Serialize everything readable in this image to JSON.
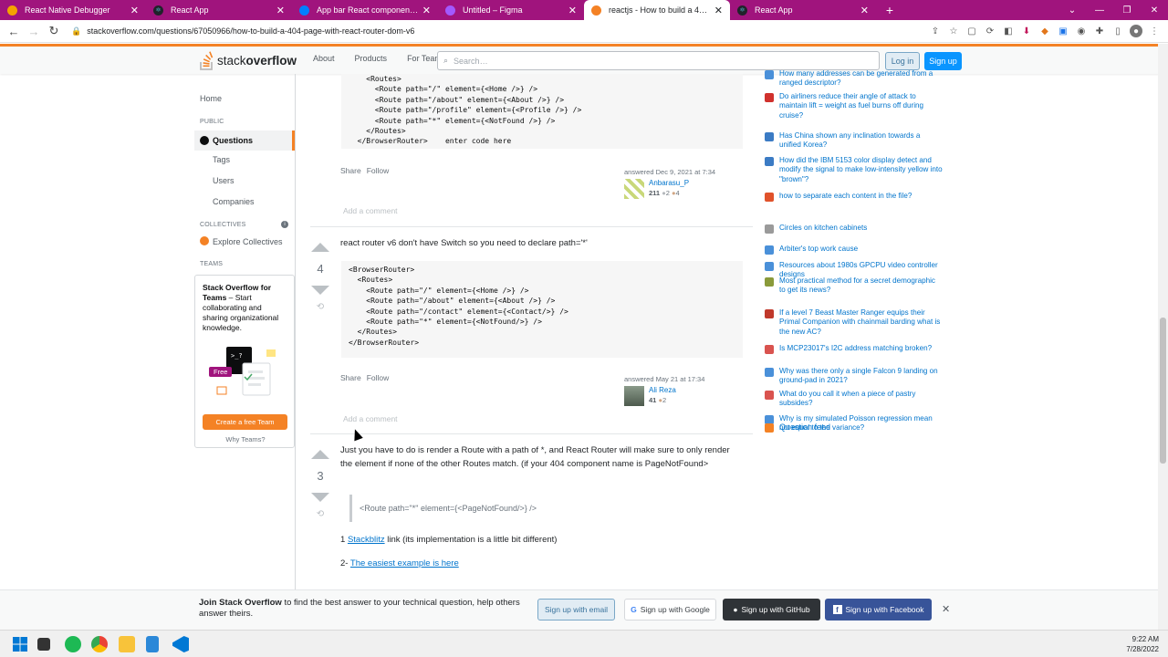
{
  "browser": {
    "tabs": [
      {
        "title": "React Native Debugger",
        "color": "#f4a300"
      },
      {
        "title": "React App",
        "color": "#20232a"
      },
      {
        "title": "App bar React component - Mat",
        "color": "#007fff"
      },
      {
        "title": "Untitled – Figma",
        "color": "#a259ff"
      },
      {
        "title": "reactjs - How to build a 404 page",
        "color": "#f48225"
      },
      {
        "title": "React App",
        "color": "#20232a"
      }
    ],
    "url": "stackoverflow.com/questions/67050966/how-to-build-a-404-page-with-react-router-dom-v6"
  },
  "so_header": {
    "logo_text_light": "stack",
    "logo_text_bold": "overflow",
    "nav": [
      "About",
      "Products",
      "For Teams"
    ],
    "search_placeholder": "Search…",
    "login": "Log in",
    "signup": "Sign up"
  },
  "leftnav": {
    "home": "Home",
    "public_header": "PUBLIC",
    "questions": "Questions",
    "tags": "Tags",
    "users": "Users",
    "companies": "Companies",
    "collectives_header": "COLLECTIVES",
    "explore_collectives": "Explore Collectives",
    "teams_header": "TEAMS",
    "teams_title": "Stack Overflow for Teams",
    "teams_body": " – Start collaborating and sharing organizational knowledge.",
    "free_badge": "Free",
    "create_team": "Create a free Team",
    "why_teams": "Why Teams?"
  },
  "answer1": {
    "code_lines": [
      "    <Routes>",
      "      <Route path=\"/\" element={<Home />} />",
      "      <Route path=\"/about\" element={<About />} />",
      "      <Route path=\"/profile\" element={<Profile />} />",
      "      <Route path=\"*\" element={<NotFound />} />",
      "    </Routes>",
      "  </BrowserRouter>    enter code here"
    ],
    "share": "Share",
    "follow": "Follow",
    "answered": "answered Dec 9, 2021 at 7:34",
    "user": "Anbarasu_P",
    "rep": "211",
    "silver": "2",
    "bronze": "4",
    "add_comment": "Add a comment"
  },
  "answer2": {
    "votes": "4",
    "text": "react router v6 don't have Switch so you need to declare path='*'",
    "code_lines": [
      "<BrowserRouter>",
      "  <Routes>",
      "    <Route path=\"/\" element={<Home />} />",
      "    <Route path=\"/about\" element={<About />} />",
      "    <Route path=\"/contact\" element={<Contact/>} />",
      "    <Route path=\"*\" element={<NotFound/>} />",
      "  </Routes>",
      "</BrowserRouter>"
    ],
    "share": "Share",
    "follow": "Follow",
    "answered": "answered May 21 at 17:34",
    "user": "Ali Reza",
    "rep": "41",
    "bronze": "2",
    "add_comment": "Add a comment"
  },
  "answer3": {
    "votes": "3",
    "text": "Just you have to do is render a Route with a path of *, and React Router will make sure to only render the element if none of the other Routes match. (if your 404 component name is PageNotFound>",
    "quote": "<Route path=\"*\" element={<PageNotFound/>} />",
    "line1_prefix": "1 ",
    "line1_link": "Stackblitz",
    "line1_suffix": " link (its implementation is a little bit different)",
    "line2_prefix": "2- ",
    "line2_link": "The easiest example is here"
  },
  "hot_questions": [
    {
      "title": "How many addresses can be generated from a ranged descriptor?",
      "color": "#4a90d9"
    },
    {
      "title": "Do airliners reduce their angle of attack to maintain lift = weight as fuel burns off during cruise?",
      "color": "#d0312d"
    },
    {
      "title": "Has China shown any inclination towards a unified Korea?",
      "color": "#3b7bc4"
    },
    {
      "title": "How did the IBM 5153 color display detect and modify the signal to make low-intensity yellow into \"brown\"?",
      "color": "#3b7bc4"
    },
    {
      "title": "how to separate each content in the file?",
      "color": "#e0522b"
    },
    {
      "title": "Circles on kitchen cabinets",
      "color": "#9a9a9a"
    },
    {
      "title": "Arbiter's top work cause",
      "color": "#4a90d9"
    },
    {
      "title": "Resources about 1980s GPCPU video controller designs",
      "color": "#4a90d9"
    },
    {
      "title": "Most practical method for a secret demographic to get its news?",
      "color": "#8a9a3a"
    },
    {
      "title": "If a level 7 Beast Master Ranger equips their Primal Companion with chainmail barding what is the new AC?",
      "color": "#c0392b"
    },
    {
      "title": "Is MCP23017's I2C address matching broken?",
      "color": "#d9534f"
    },
    {
      "title": "Why was there only a single Falcon 9 landing on ground-pad in 2021?",
      "color": "#4a90d9"
    },
    {
      "title": "What do you call it when a piece of pastry subsides?",
      "color": "#d9534f"
    },
    {
      "title": "Why is my simulated Poisson regression mean not equal to the variance?",
      "color": "#4a90d9"
    }
  ],
  "question_feed": "Question feed",
  "banner": {
    "bold": "Join Stack Overflow",
    "text": " to find the best answer to your technical question, help others answer theirs.",
    "email": "Sign up with email",
    "google": "Sign up with Google",
    "github": "Sign up with GitHub",
    "facebook": "Sign up with Facebook"
  },
  "clock": {
    "time": "9:22 AM",
    "date": "7/28/2022"
  }
}
